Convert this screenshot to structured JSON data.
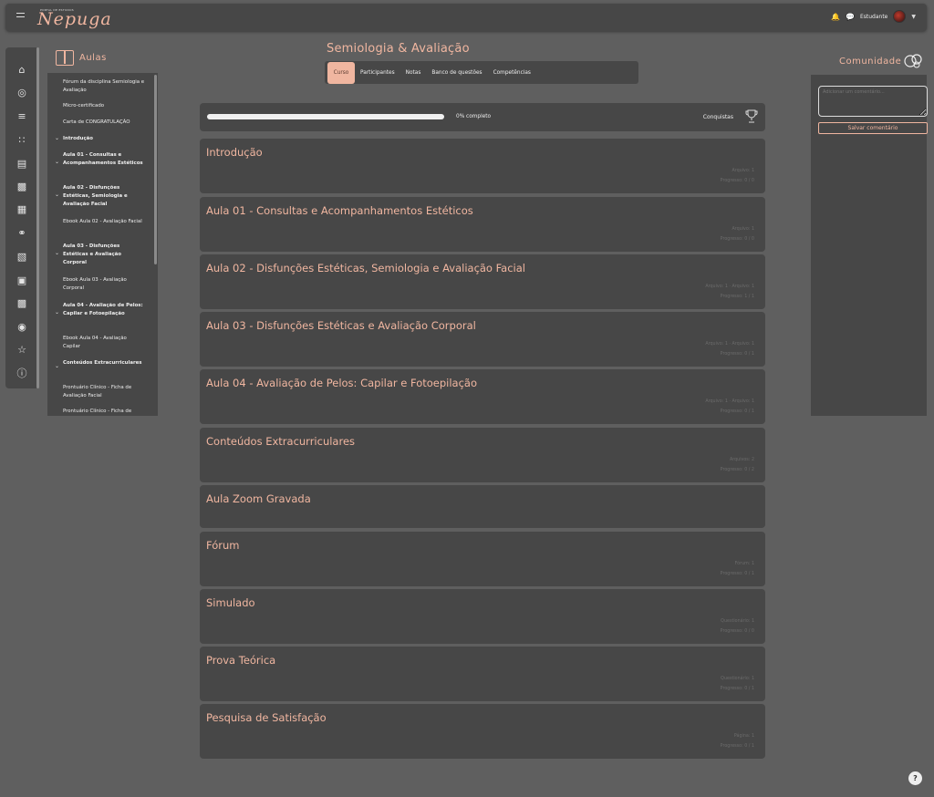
{
  "header": {
    "logo_small": "PORTAL DE ESTUDOS",
    "logo": "Nepuga",
    "user_name": "Estudante"
  },
  "rail": {
    "icons": [
      "home-icon",
      "compass-icon",
      "sliders-icon",
      "grid-icon",
      "book-open-icon",
      "report-icon",
      "calendar-icon",
      "chat-icon",
      "chart-icon",
      "presentation-icon",
      "box-icon",
      "play-circle-icon",
      "star-icon",
      "info-icon"
    ]
  },
  "aulas": {
    "title": "Aulas",
    "items": [
      {
        "label": "Fórum da disciplina Semiologia e Avaliação",
        "bold": false
      },
      {
        "label": "Micro-certificado",
        "bold": false
      },
      {
        "label": "Carta de CONGRATULAÇÃO",
        "bold": false
      },
      {
        "label": "Introdução",
        "bold": true
      },
      {
        "label": "Aula 01 - Consultas e Acompanhamentos Estéticos",
        "bold": true
      },
      {
        "label": "Aula 02 - Disfunções Estéticas, Semiologia e Avaliação Facial",
        "bold": true
      },
      {
        "label": "Ebook Aula 02 - Avaliação Facial",
        "bold": false
      },
      {
        "label": "Aula 03 - Disfunções Estéticas e Avaliação Corporal",
        "bold": true
      },
      {
        "label": "Ebook Aula 03 - Avaliação Corporal",
        "bold": false
      },
      {
        "label": "Aula 04 - Avaliação de Pelos: Capilar e Fotoepilação",
        "bold": true
      },
      {
        "label": "Ebook Aula 04 - Avaliação Capilar",
        "bold": false
      },
      {
        "label": "Conteúdos Extracurriculares",
        "bold": true
      },
      {
        "label": "Prontuário Clínico - Ficha de Avaliação Facial",
        "bold": false
      },
      {
        "label": "Prontuário Clínico - Ficha de",
        "bold": false
      }
    ]
  },
  "course": {
    "title": "Semiologia & Avaliação",
    "tabs": [
      "Curso",
      "Participantes",
      "Notas",
      "Banco de questões",
      "Competências"
    ]
  },
  "progress": {
    "value": 0,
    "label": "0% completo",
    "achievements": "Conquistas"
  },
  "sections": [
    {
      "title": "Introdução",
      "meta1": "Arquivo: 1",
      "meta2": "Progresso: 0 / 0"
    },
    {
      "title": "Aula 01 - Consultas e Acompanhamentos Estéticos",
      "meta1": "Arquivo: 1",
      "meta2": "Progresso: 0 / 0"
    },
    {
      "title": "Aula 02 - Disfunções Estéticas, Semiologia e Avaliação Facial",
      "meta1": "Arquivo: 1 · Arquivo: 1",
      "meta2": "Progresso: 1 / 1"
    },
    {
      "title": "Aula 03 - Disfunções Estéticas e Avaliação Corporal",
      "meta1": "Arquivo: 1 · Arquivo: 1",
      "meta2": "Progresso: 0 / 1"
    },
    {
      "title": "Aula 04 - Avaliação de Pelos: Capilar e Fotoepilação",
      "meta1": "Arquivo: 1 · Arquivo: 1",
      "meta2": "Progresso: 0 / 1"
    },
    {
      "title": "Conteúdos Extracurriculares",
      "meta1": "Arquivos: 2",
      "meta2": "Progresso: 0 / 2"
    },
    {
      "title": "Aula Zoom Gravada",
      "meta1": "",
      "meta2": ""
    },
    {
      "title": "Fórum",
      "meta1": "Fórum: 1",
      "meta2": "Progresso: 0 / 1"
    },
    {
      "title": "Simulado",
      "meta1": "Questionário: 1",
      "meta2": "Progresso: 0 / 0"
    },
    {
      "title": "Prova Teórica",
      "meta1": "Questionário: 1",
      "meta2": "Progresso: 0 / 1"
    },
    {
      "title": "Pesquisa de Satisfação",
      "meta1": "Página: 1",
      "meta2": "Progresso: 0 / 1"
    }
  ],
  "community": {
    "title": "Comunidade",
    "placeholder": "Adicionar um comentário...",
    "save_label": "Salvar comentário"
  },
  "help": "?",
  "colors": {
    "accent": "#f0b6a0",
    "panel": "#474747",
    "background": "#5f5f5f",
    "notification": "#e84f4f"
  }
}
